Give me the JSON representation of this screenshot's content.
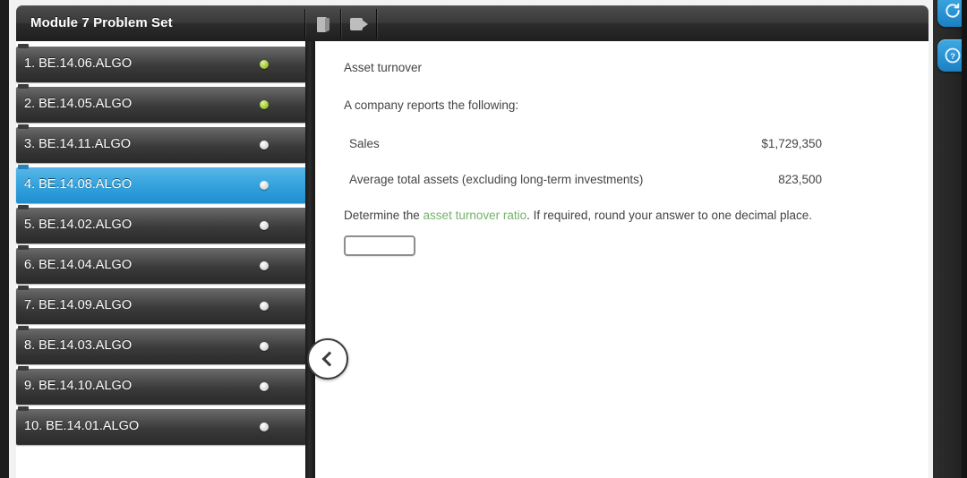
{
  "header": {
    "title": "Module 7 Problem Set",
    "toolbar": [
      {
        "name": "ebook-icon",
        "label": "eBook"
      },
      {
        "name": "video-icon",
        "label": "Video"
      }
    ]
  },
  "sidebar": {
    "collapse_label": "<",
    "items": [
      {
        "num": "1.",
        "code": "BE.14.06.ALGO",
        "label": "1.  BE.14.06.ALGO",
        "status": "done",
        "selected": false
      },
      {
        "num": "2.",
        "code": "BE.14.05.ALGO",
        "label": "2.  BE.14.05.ALGO",
        "status": "done",
        "selected": false
      },
      {
        "num": "3.",
        "code": "BE.14.11.ALGO",
        "label": "3.  BE.14.11.ALGO",
        "status": "pending",
        "selected": false
      },
      {
        "num": "4.",
        "code": "BE.14.08.ALGO",
        "label": "4.  BE.14.08.ALGO",
        "status": "pending",
        "selected": true
      },
      {
        "num": "5.",
        "code": "BE.14.02.ALGO",
        "label": "5.  BE.14.02.ALGO",
        "status": "pending",
        "selected": false
      },
      {
        "num": "6.",
        "code": "BE.14.04.ALGO",
        "label": "6.  BE.14.04.ALGO",
        "status": "pending",
        "selected": false
      },
      {
        "num": "7.",
        "code": "BE.14.09.ALGO",
        "label": "7.  BE.14.09.ALGO",
        "status": "pending",
        "selected": false
      },
      {
        "num": "8.",
        "code": "BE.14.03.ALGO",
        "label": "8.  BE.14.03.ALGO",
        "status": "pending",
        "selected": false
      },
      {
        "num": "9.",
        "code": "BE.14.10.ALGO",
        "label": "9.  BE.14.10.ALGO",
        "status": "pending",
        "selected": false
      },
      {
        "num": "10.",
        "code": "BE.14.01.ALGO",
        "label": "10.  BE.14.01.ALGO",
        "status": "pending",
        "selected": false
      }
    ]
  },
  "problem": {
    "title": "Asset turnover",
    "intro": "A company reports the following:",
    "facts": [
      {
        "label": "Sales",
        "value": "$1,729,350"
      },
      {
        "label": "Average total assets (excluding long-term investments)",
        "value": "823,500"
      }
    ],
    "question_pre": "Determine the ",
    "question_link": "asset turnover ratio",
    "question_post": ". If required, round your answer to one decimal place.",
    "answer_value": "",
    "answer_placeholder": ""
  },
  "right_rail": {
    "buttons": [
      {
        "name": "refresh-icon",
        "label": "Refresh"
      },
      {
        "name": "help-icon",
        "label": "Help"
      }
    ]
  },
  "colors": {
    "accent_blue": "#2a93d4",
    "selected_row": "#2f9ad6",
    "link_green": "#73b46b",
    "status_done": "#a7cf3a",
    "header_dark": "#3a3a3a"
  }
}
